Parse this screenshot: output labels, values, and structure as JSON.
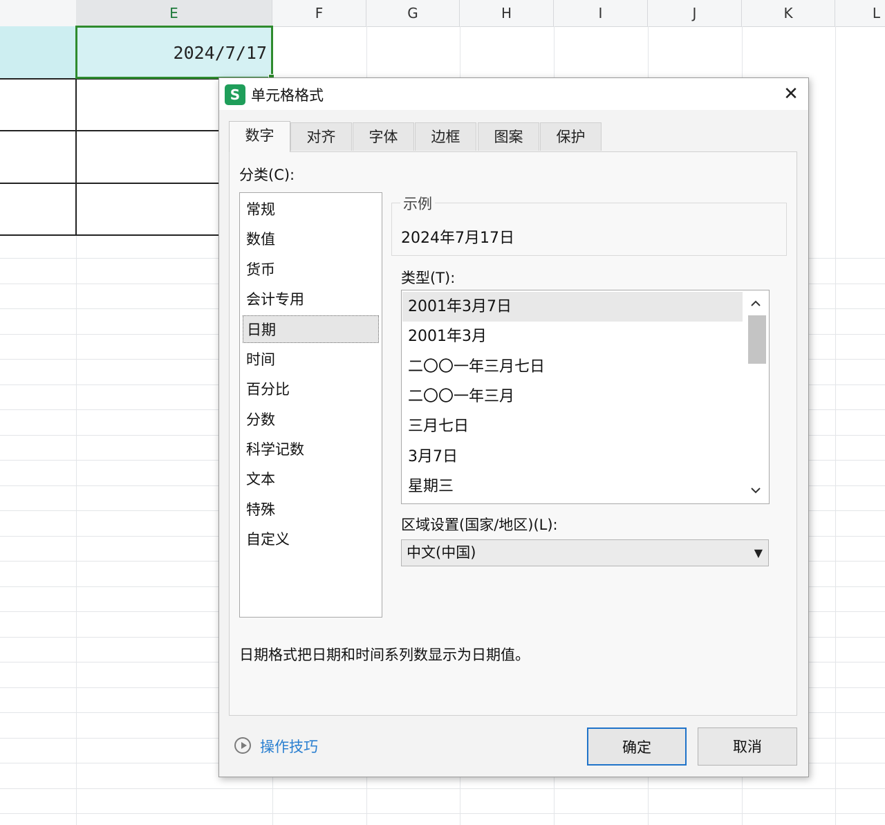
{
  "sheet": {
    "columns": [
      "E",
      "F",
      "G",
      "H",
      "I",
      "J",
      "K",
      "L"
    ],
    "selected_cell_value": "2024/7/17"
  },
  "dialog": {
    "title": "单元格格式",
    "app_logo": "S",
    "close_glyph": "✕",
    "tabs": [
      "数字",
      "对齐",
      "字体",
      "边框",
      "图案",
      "保护"
    ],
    "active_tab": "数字",
    "category_label": "分类(C):",
    "categories": [
      "常规",
      "数值",
      "货币",
      "会计专用",
      "日期",
      "时间",
      "百分比",
      "分数",
      "科学记数",
      "文本",
      "特殊",
      "自定义"
    ],
    "selected_category": "日期",
    "sample_label": "示例",
    "sample_value": "2024年7月17日",
    "type_label": "类型(T):",
    "types": [
      "2001年3月7日",
      "2001年3月",
      "二〇〇一年三月七日",
      "二〇〇一年三月",
      "三月七日",
      "3月7日",
      "星期三"
    ],
    "selected_type": "2001年3月7日",
    "locale_label": "区域设置(国家/地区)(L):",
    "locale_value": "中文(中国)",
    "description": "日期格式把日期和时间系列数显示为日期值。",
    "tips_label": "操作技巧",
    "ok_label": "确定",
    "cancel_label": "取消"
  },
  "icons": {
    "close": "close-icon",
    "scroll_up": "chevron-up-icon",
    "scroll_down": "chevron-down-icon",
    "dropdown": "triangle-down-icon",
    "tips": "play-circle-icon"
  },
  "colors": {
    "selection_border": "#2e8b2e",
    "selection_fill": "#d5f1f3",
    "primary_button_border": "#1f73c9",
    "link": "#2a7fd0",
    "logo": "#1f9e5a"
  }
}
